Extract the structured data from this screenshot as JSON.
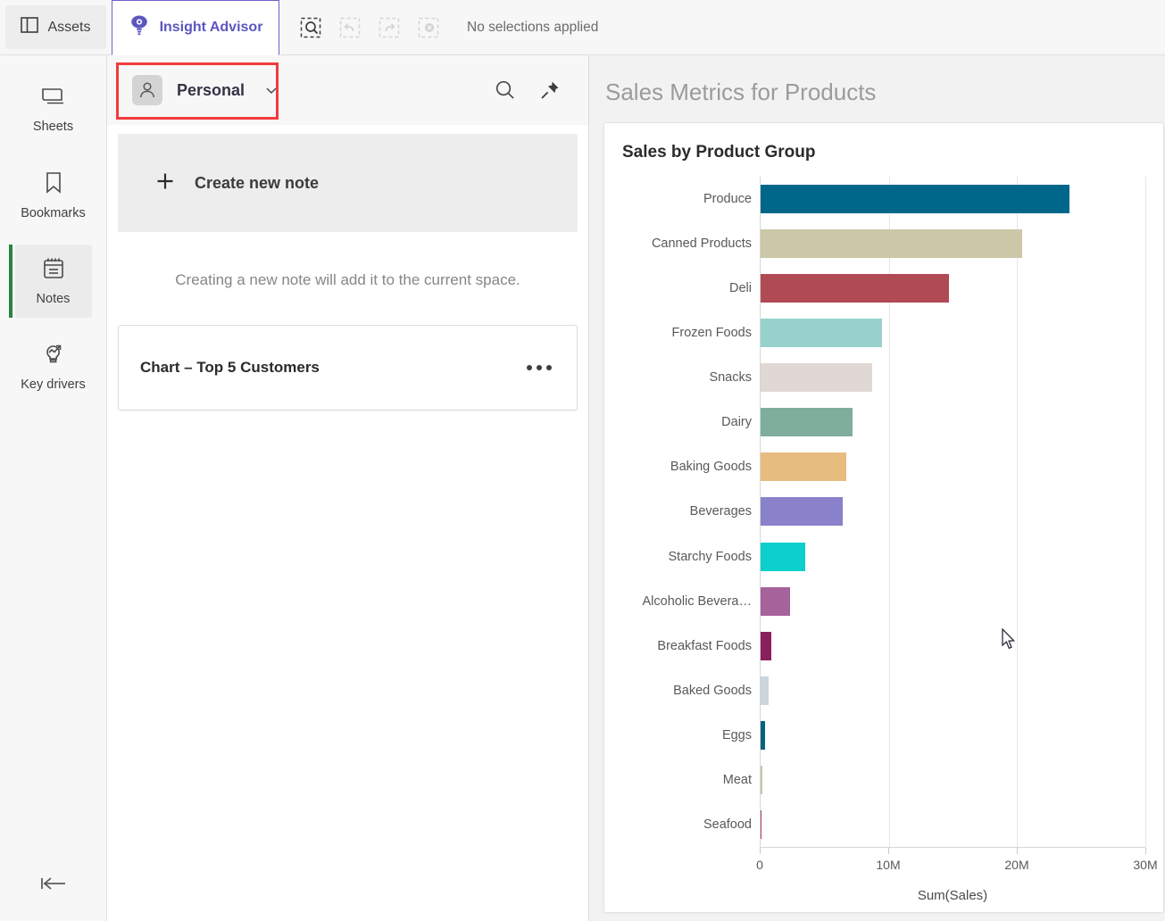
{
  "topbar": {
    "assets_tab": "Assets",
    "insight_advisor_tab": "Insight Advisor",
    "selections_status": "No selections applied",
    "accent_purple": "#5c56c0",
    "icons": {
      "assets": "panel-icon",
      "insight_advisor": "lightbulb-eye-icon",
      "selection_search": "selection-search-icon",
      "undo": "undo-icon",
      "redo": "redo-icon",
      "clear": "clear-selections-icon"
    }
  },
  "rail": {
    "items": [
      {
        "label": "Sheets",
        "icon": "sheets-icon",
        "active": false
      },
      {
        "label": "Bookmarks",
        "icon": "bookmark-icon",
        "active": false
      },
      {
        "label": "Notes",
        "icon": "notes-icon",
        "active": true
      },
      {
        "label": "Key drivers",
        "icon": "key-drivers-icon",
        "active": false
      }
    ],
    "active_marker_color": "#28853f",
    "collapse_icon": "collapse-left-icon"
  },
  "notes": {
    "space_name": "Personal",
    "space_icon": "person-icon",
    "chevron_icon": "chevron-down-icon",
    "search_icon": "search-icon",
    "pin_icon": "pin-icon",
    "create_label": "Create new note",
    "create_icon": "plus-icon",
    "hint": "Creating a new note will add it to the current space.",
    "cards": [
      {
        "title": "Chart – Top 5 Customers",
        "menu_icon": "kebab-menu-icon"
      }
    ],
    "highlight_color": "#f13c3c"
  },
  "content": {
    "title": "Sales Metrics for Products"
  },
  "chart_data": {
    "type": "bar",
    "orientation": "horizontal",
    "title": "Sales by Product Group",
    "xlabel": "Sum(Sales)",
    "ylabel": "",
    "xlim": [
      0,
      30000000
    ],
    "xticks": [
      0,
      10000000,
      20000000,
      30000000
    ],
    "xtick_labels": [
      "0",
      "10M",
      "20M",
      "30M"
    ],
    "grid": true,
    "legend": false,
    "categories": [
      "Produce",
      "Canned Products",
      "Deli",
      "Frozen Foods",
      "Snacks",
      "Dairy",
      "Baking Goods",
      "Beverages",
      "Starchy Foods",
      "Alcoholic Bevera…",
      "Breakfast Foods",
      "Baked Goods",
      "Eggs",
      "Meat",
      "Seafood"
    ],
    "values": [
      24100000,
      20400000,
      14700000,
      9500000,
      8700000,
      7200000,
      6700000,
      6400000,
      3500000,
      2300000,
      850000,
      600000,
      370000,
      150000,
      100000
    ],
    "colors": [
      "#00668a",
      "#cbc7a7",
      "#b04a55",
      "#96d1cb",
      "#e0d8d4",
      "#7fae9d",
      "#e7bd7f",
      "#8a81cb",
      "#0dcfce",
      "#a5629b",
      "#8a1f5e",
      "#ccd4dc",
      "#06647d",
      "#cbc7a7",
      "#b04a55"
    ]
  }
}
